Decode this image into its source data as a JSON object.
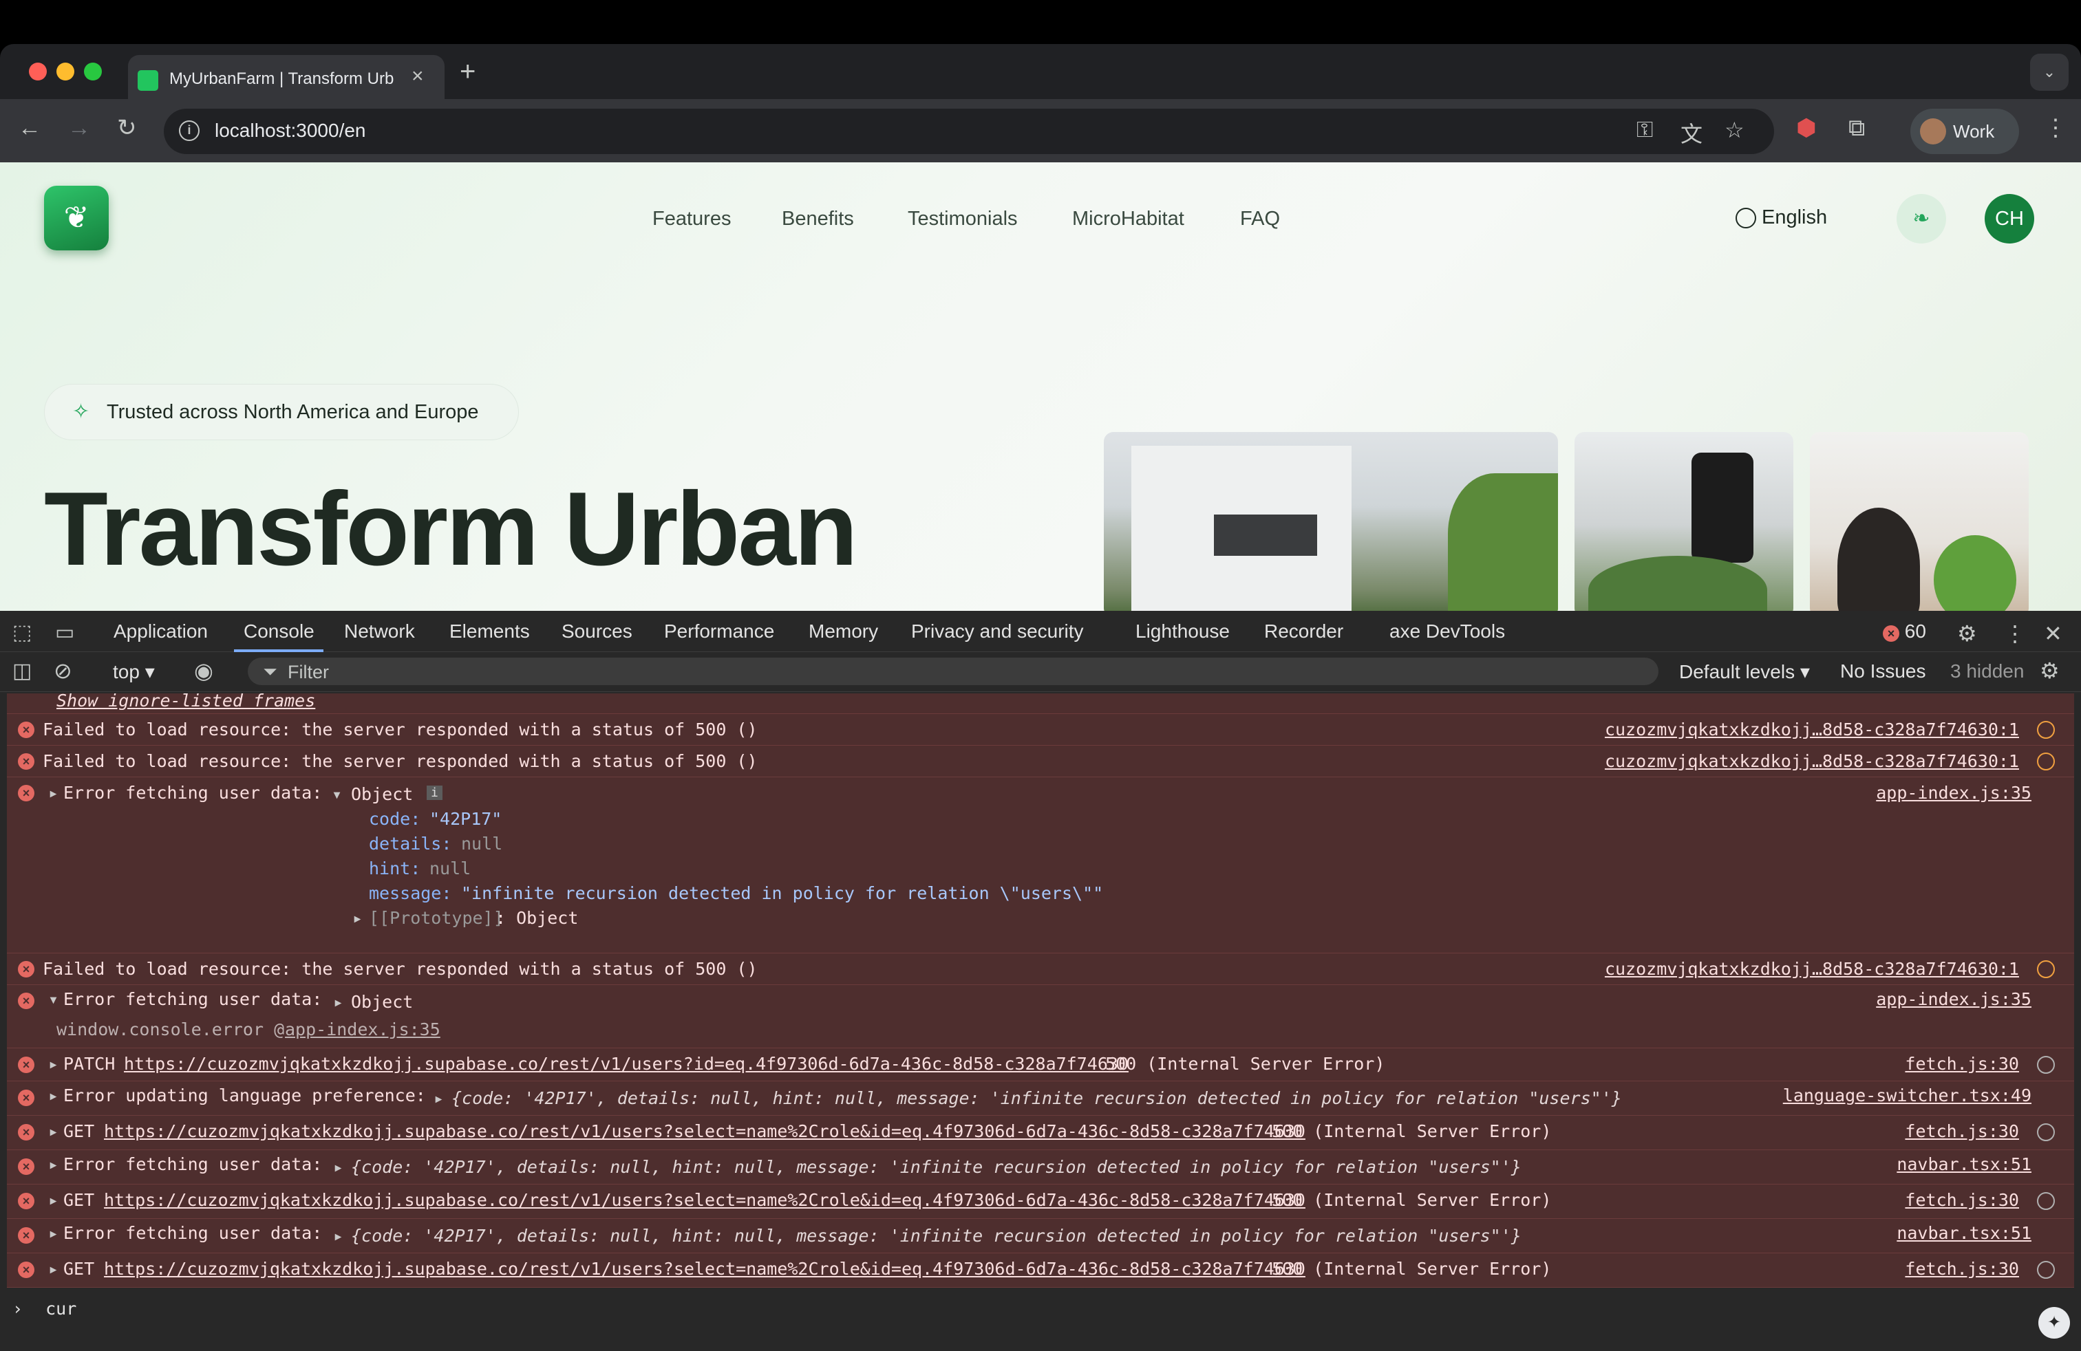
{
  "browser": {
    "tab_title": "MyUrbanFarm | Transform Urban",
    "url": "localhost:3000/en",
    "profile_name": "Work"
  },
  "site": {
    "nav": [
      "Features",
      "Benefits",
      "Testimonials",
      "MicroHabitat",
      "FAQ"
    ],
    "language": "English",
    "avatar_initials": "CH",
    "badge": "Trusted across North America and Europe",
    "hero_title": "Transform Urban",
    "accent_color": "#15803d"
  },
  "devtools": {
    "tabs": [
      "Application",
      "Console",
      "Network",
      "Elements",
      "Sources",
      "Performance",
      "Memory",
      "Privacy and security",
      "Lighthouse",
      "Recorder",
      "axe DevTools"
    ],
    "error_count": "60",
    "context": "top",
    "filter_placeholder": "Filter",
    "levels": "Default levels",
    "issues": "No Issues",
    "hidden": "3 hidden",
    "prompt_input": "cur",
    "show_ignored": "Show ignore-listed frames"
  },
  "console": {
    "failed_load": "Failed to load resource: the server responded with a status of 500 ()",
    "resource_src": "cuzozmvjqkatxkzdkojj…8d58-c328a7f74630:1",
    "err_user": "Error fetching user data:",
    "obj_label": "Object",
    "obj_code": "\"42P17\"",
    "obj_details": "null",
    "obj_hint": "null",
    "obj_message": "\"infinite recursion detected in policy for relation \\\"users\\\"\"",
    "obj_proto": "[[Prototype]]",
    "app_src": "app-index.js:35",
    "console_error": "window.console.error @",
    "patch_method": "PATCH",
    "patch_url": "https://cuzozmvjqkatxkzdkojj.supabase.co/rest/v1/users?id=eq.4f97306d-6d7a-436c-8d58-c328a7f74630",
    "status_500": "500 (Internal Server Error)",
    "fetch_src": "fetch.js:30",
    "err_lang": "Error updating language preference:",
    "inline_obj": "{code: '42P17', details: null, hint: null, message: 'infinite recursion detected in policy for relation \"users\"'}",
    "lang_src": "language-switcher.tsx:49",
    "get_method": "GET",
    "get_url": "https://cuzozmvjqkatxkzdkojj.supabase.co/rest/v1/users?select=name%2Crole&id=eq.4f97306d-6d7a-436c-8d58-c328a7f74630",
    "navbar_src": "navbar.tsx:51"
  }
}
